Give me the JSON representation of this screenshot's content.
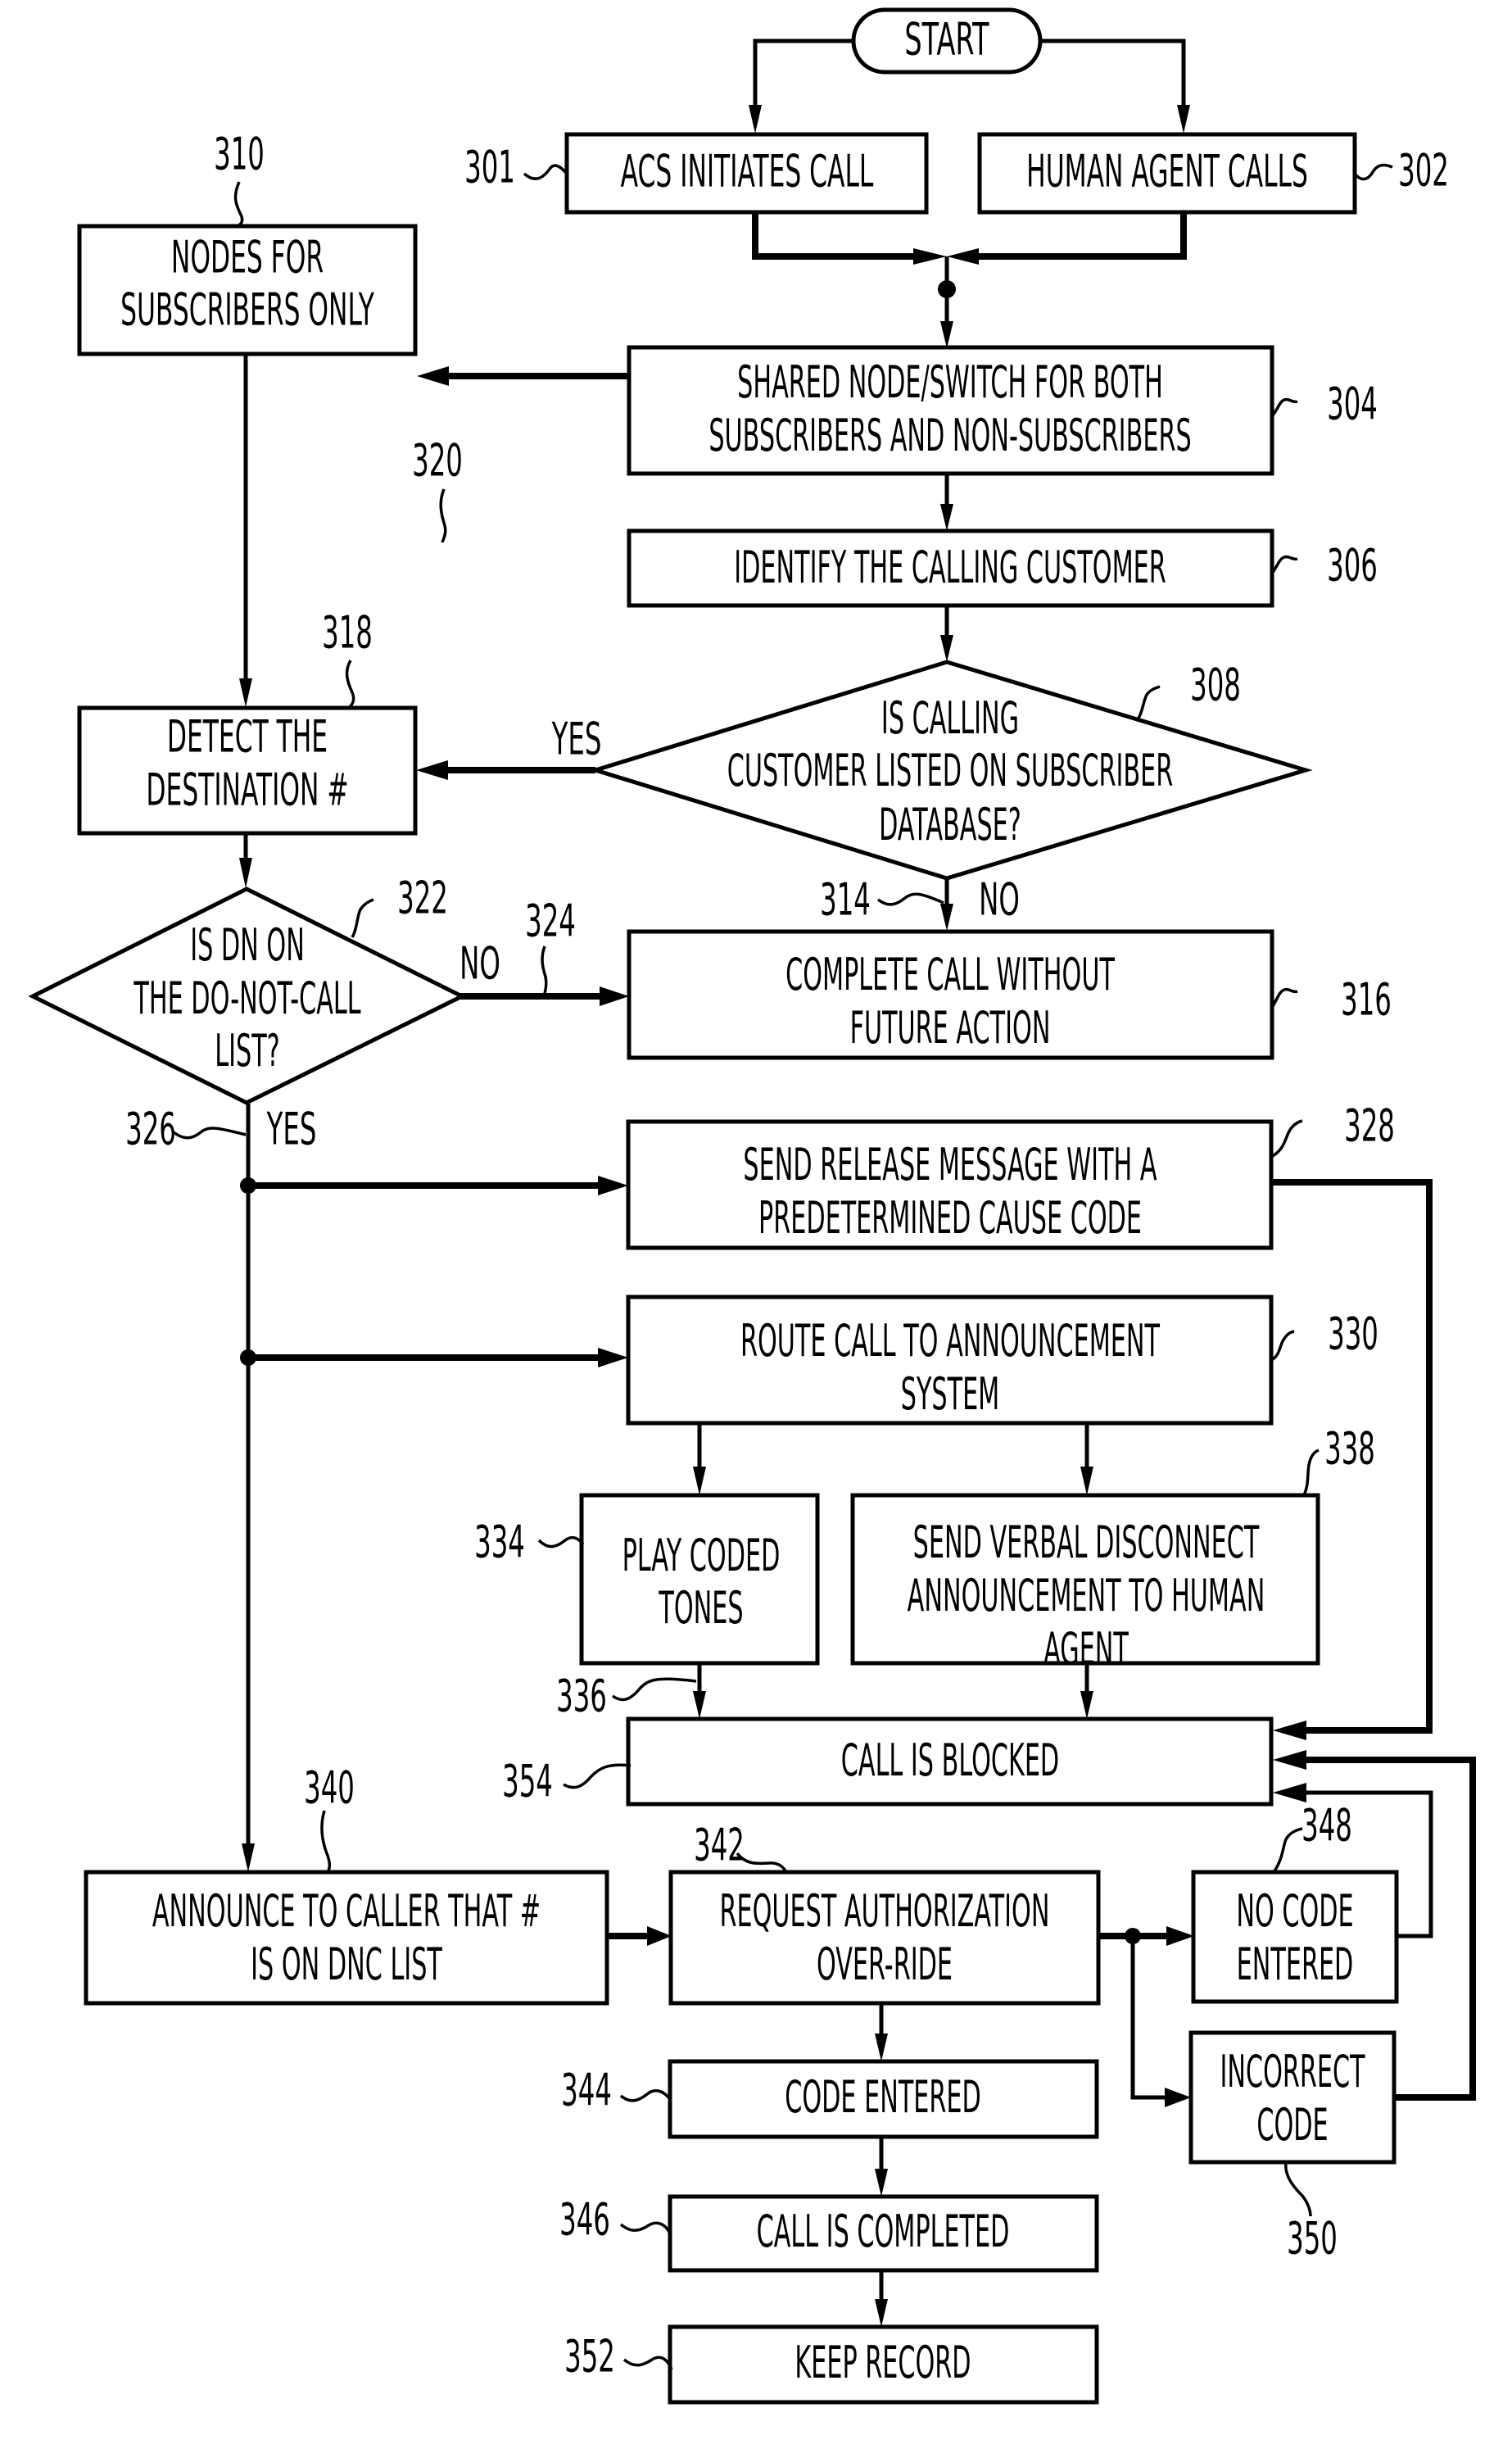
{
  "diagram": {
    "type": "flowchart",
    "start": {
      "label": "START"
    },
    "nodes": {
      "n301": {
        "ref": "301",
        "lines": [
          "ACS INITIATES CALL"
        ]
      },
      "n302": {
        "ref": "302",
        "lines": [
          "HUMAN AGENT CALLS"
        ]
      },
      "n310": {
        "ref": "310",
        "lines": [
          "NODES FOR",
          "SUBSCRIBERS ONLY"
        ]
      },
      "n304": {
        "ref": "304",
        "lines": [
          "SHARED NODE/SWITCH FOR BOTH",
          "SUBSCRIBERS AND NON-SUBSCRIBERS"
        ]
      },
      "n306": {
        "ref": "306",
        "lines": [
          "IDENTIFY THE CALLING CUSTOMER"
        ]
      },
      "n308": {
        "ref": "308",
        "lines": [
          "IS CALLING",
          "CUSTOMER LISTED ON SUBSCRIBER",
          "DATABASE?"
        ]
      },
      "n318": {
        "ref": "318",
        "lines": [
          "DETECT THE",
          "DESTINATION #"
        ]
      },
      "n322": {
        "ref": "322",
        "lines": [
          "IS DN ON",
          "THE DO-NOT-CALL",
          "LIST?"
        ]
      },
      "n316": {
        "ref": "316",
        "lines": [
          "COMPLETE CALL WITHOUT",
          "FUTURE ACTION"
        ]
      },
      "n328": {
        "ref": "328",
        "lines": [
          "SEND RELEASE MESSAGE WITH A",
          "PREDETERMINED CAUSE CODE"
        ]
      },
      "n330": {
        "ref": "330",
        "lines": [
          "ROUTE CALL TO ANNOUNCEMENT",
          "SYSTEM"
        ]
      },
      "n334": {
        "ref": "334",
        "lines": [
          "PLAY CODED",
          "TONES"
        ]
      },
      "n338": {
        "ref": "338",
        "lines": [
          "SEND VERBAL DISCONNECT",
          "ANNOUNCEMENT TO HUMAN",
          "AGENT"
        ]
      },
      "n354": {
        "ref": "354",
        "lines": [
          "CALL IS BLOCKED"
        ]
      },
      "n340": {
        "ref": "340",
        "lines": [
          "ANNOUNCE TO CALLER THAT #",
          "IS ON DNC LIST"
        ]
      },
      "n342": {
        "ref": "342",
        "lines": [
          "REQUEST AUTHORIZATION",
          "OVER-RIDE"
        ]
      },
      "n348": {
        "ref": "348",
        "lines": [
          "NO CODE",
          "ENTERED"
        ]
      },
      "n350": {
        "ref": "350",
        "lines": [
          "INCORRECT",
          "CODE"
        ]
      },
      "n344": {
        "ref": "344",
        "lines": [
          "CODE ENTERED"
        ]
      },
      "n346": {
        "ref": "346",
        "lines": [
          "CALL IS COMPLETED"
        ]
      },
      "n352": {
        "ref": "352",
        "lines": [
          "KEEP RECORD"
        ]
      }
    },
    "path_refs": {
      "r314": "314",
      "r320": "320",
      "r324": "324",
      "r326": "326",
      "r336": "336"
    },
    "branch_labels": {
      "yes_308": "YES",
      "no_308": "NO",
      "no_322": "NO",
      "yes_322": "YES"
    }
  }
}
